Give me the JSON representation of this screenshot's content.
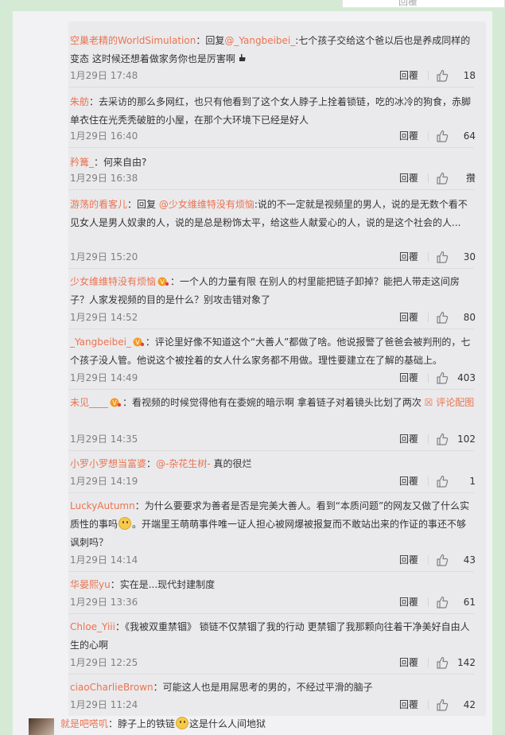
{
  "top_ghost_text": "回覆",
  "comments": [
    {
      "parts": [
        {
          "t": "user",
          "v": "空巢老精的WorldSimulation"
        },
        {
          "t": "text",
          "v": "：回复"
        },
        {
          "t": "mention",
          "v": "@_Yangbeibei_"
        },
        {
          "t": "text",
          "v": ":七个孩子交给这个爸以后也是养成同样的变态 这时候还想着做家务你也是厉害啊"
        },
        {
          "t": "icon",
          "v": "hand-icon"
        }
      ],
      "date": "1月29日 17:48",
      "reply": "回覆",
      "likes": "18"
    },
    {
      "parts": [
        {
          "t": "user",
          "v": "朱舫"
        },
        {
          "t": "text",
          "v": "：去采访的那么多网红，也只有他看到了这个女人脖子上拴着锁链，吃的冰冷的狗食，赤脚单衣住在光秃秃破脏的小屋，在那个大环境下已经是好人"
        }
      ],
      "date": "1月29日 16:40",
      "reply": "回覆",
      "likes": "64"
    },
    {
      "parts": [
        {
          "t": "user",
          "v": "矜篝_"
        },
        {
          "t": "text",
          "v": "：何来自由?"
        }
      ],
      "date": "1月29日 16:38",
      "reply": "回覆",
      "likes": "攢"
    },
    {
      "parts": [
        {
          "t": "user",
          "v": "游荡的看客儿"
        },
        {
          "t": "text",
          "v": "：回复 "
        },
        {
          "t": "mention",
          "v": "@少女维维特没有烦恼"
        },
        {
          "t": "text",
          "v": ":说的不一定就是视频里的男人，说的是无数个看不见女人是男人奴隶的人，说的是总是粉饰太平，给这些人献爱心的人，说的是这个社会的人..."
        }
      ],
      "date": "1月29日 15:20",
      "reply": "回覆",
      "likes": "30"
    },
    {
      "parts": [
        {
          "t": "user",
          "v": "少女维维特没有烦恼"
        },
        {
          "t": "badge",
          "v": "vip-badge"
        },
        {
          "t": "text",
          "v": "：一个人的力量有限 在别人的村里能把链子卸掉？能把人带走这间房子？人家发视频的目的是什么？别攻击错对象了"
        }
      ],
      "date": "1月29日 14:52",
      "reply": "回覆",
      "likes": "80"
    },
    {
      "parts": [
        {
          "t": "user",
          "v": "_Yangbeibei_"
        },
        {
          "t": "badge",
          "v": "vip-badge"
        },
        {
          "t": "text",
          "v": "：评论里好像不知道这个“大善人”都做了啥。他说报警了爸爸会被判刑的，七个孩子没人管。他说这个被拴着的女人什么家务都不用做。理性要建立在了解的基础上。"
        }
      ],
      "date": "1月29日 14:49",
      "reply": "回覆",
      "likes": "403"
    },
    {
      "parts": [
        {
          "t": "user",
          "v": "未见____"
        },
        {
          "t": "badge",
          "v": "vip-badge"
        },
        {
          "t": "text",
          "v": "：看视频的时候觉得他有在委婉的暗示啊 拿着链子对着镜头比划了两次 "
        },
        {
          "t": "link",
          "v": "☒ 评论配图"
        }
      ],
      "date": "1月29日 14:35",
      "reply": "回覆",
      "likes": "102"
    },
    {
      "parts": [
        {
          "t": "user",
          "v": "小罗小罗想当富婆"
        },
        {
          "t": "text",
          "v": "："
        },
        {
          "t": "mention",
          "v": "@-杂花生树-"
        },
        {
          "t": "text",
          "v": " 真的很烂"
        }
      ],
      "date": "1月29日 14:19",
      "reply": "回覆",
      "likes": "1"
    },
    {
      "parts": [
        {
          "t": "user",
          "v": "LuckyAutumn"
        },
        {
          "t": "text",
          "v": "：为什么要要求为善者是否是完美大善人。看到“本质问题”的网友又做了什么实质性的事吗"
        },
        {
          "t": "emoji",
          "v": "thinking-emoji"
        },
        {
          "t": "text",
          "v": "。开端里王萌萌事件唯一证人担心被网爆被报复而不敢站出来的作证的事还不够讽刺吗？"
        }
      ],
      "date": "1月29日 14:14",
      "reply": "回覆",
      "likes": "43"
    },
    {
      "parts": [
        {
          "t": "user",
          "v": "华晏熙yu"
        },
        {
          "t": "text",
          "v": "：实在是...现代封建制度"
        }
      ],
      "date": "1月29日 13:36",
      "reply": "回覆",
      "likes": "61"
    },
    {
      "parts": [
        {
          "t": "user",
          "v": "Chloe_Yiii"
        },
        {
          "t": "text",
          "v": "：《我被双重禁锢》 锁链不仅禁锢了我的行动 更禁锢了我那颗向往着干净美好自由人生的心啊"
        }
      ],
      "date": "1月29日 12:25",
      "reply": "回覆",
      "likes": "142"
    },
    {
      "parts": [
        {
          "t": "user",
          "v": "ciaoCharlieBrown"
        },
        {
          "t": "text",
          "v": "：可能这人也是用屌思考的男的，不经过平滑的脑子"
        }
      ],
      "date": "1月29日 11:24",
      "reply": "回覆",
      "likes": "42"
    }
  ],
  "bottom_comment": {
    "user": "就是吧嗒叽",
    "text1": "：脖子上的铁链",
    "text2": "这是什么人间地狱"
  },
  "colors": {
    "accent": "#eb7350",
    "background": "#d4ead4",
    "panel": "#f2f2f5",
    "list": "#eaeaec"
  }
}
